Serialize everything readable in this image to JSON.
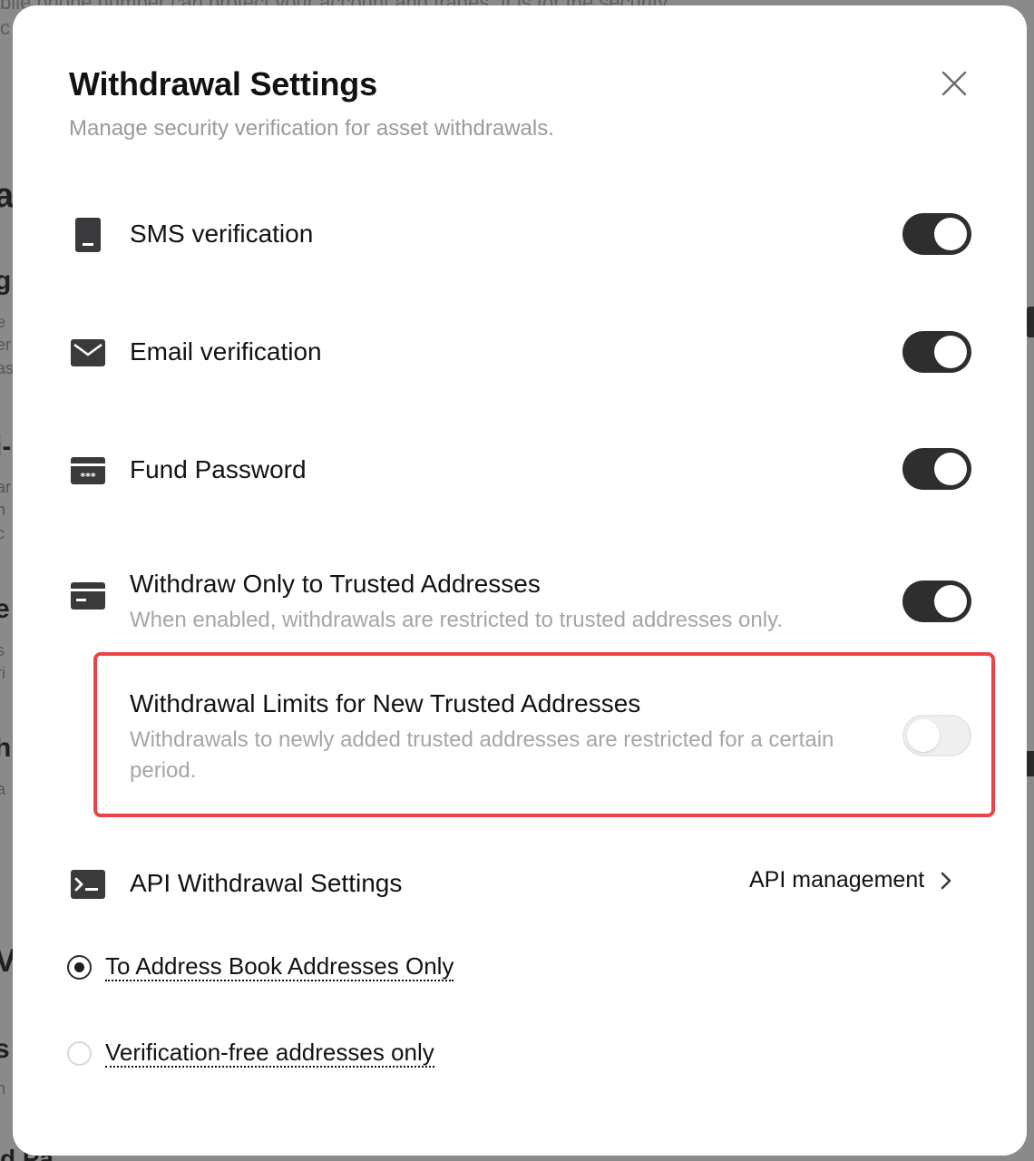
{
  "background": {
    "top_text": "bile phone number can protect your account and trades. It is for the security",
    "top_text_2": "c",
    "fragments": [
      "al",
      "gi",
      "e",
      "er",
      "as",
      "i-",
      "ar",
      "h",
      "c",
      "e",
      "s",
      "ri",
      "h",
      "a",
      "V",
      "s",
      "n",
      "d Pa"
    ]
  },
  "modal": {
    "title": "Withdrawal Settings",
    "subtitle": "Manage security verification for asset withdrawals.",
    "close_icon": "close-icon",
    "settings": [
      {
        "icon": "phone-icon",
        "label": "SMS verification",
        "enabled": true
      },
      {
        "icon": "mail-icon",
        "label": "Email verification",
        "enabled": true
      },
      {
        "icon": "password-card-icon",
        "label": "Fund Password",
        "enabled": true
      },
      {
        "icon": "card-icon",
        "label": "Withdraw Only to Trusted Addresses",
        "description": "When enabled, withdrawals are restricted to trusted addresses only.",
        "enabled": true
      },
      {
        "label": "Withdrawal Limits for New Trusted Addresses",
        "description": "Withdrawals to newly added trusted addresses are restricted for a certain period.",
        "enabled": false,
        "highlighted": true
      }
    ],
    "api": {
      "icon": "terminal-icon",
      "label": "API Withdrawal Settings",
      "link_label": "API management",
      "options": [
        {
          "label": "To Address Book Addresses Only",
          "selected": true
        },
        {
          "label": "Verification-free addresses only",
          "selected": false
        }
      ]
    },
    "highlight_color": "#e8454a",
    "toggle_on_color": "#2e2e2e"
  }
}
